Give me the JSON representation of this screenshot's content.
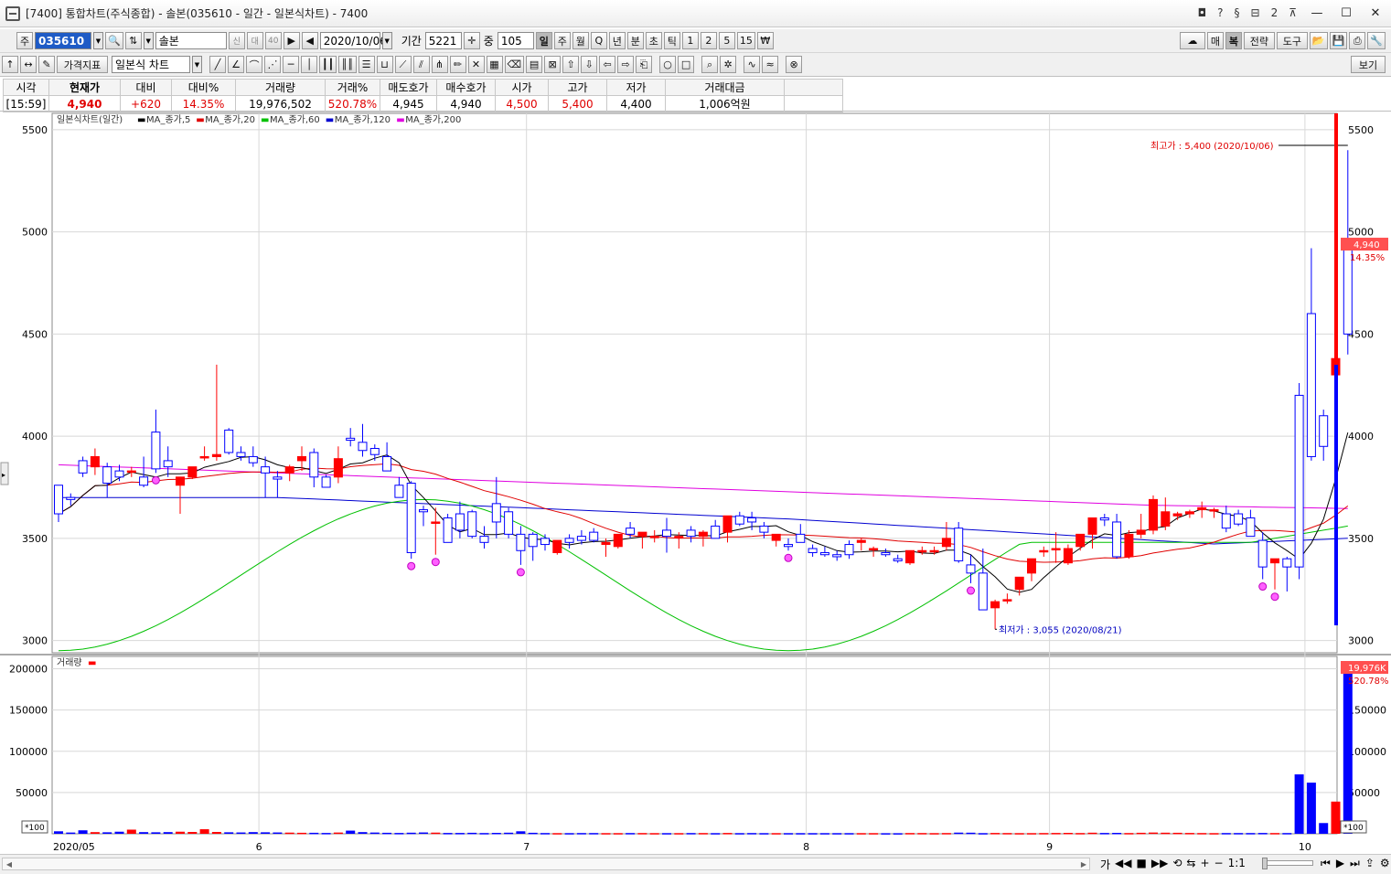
{
  "window": {
    "title": "[7400] 통합차트(주식종합) - 솔본(035610 - 일간 - 일본식차트) - 7400",
    "title_buttons": [
      "◘",
      "?",
      "§",
      "⊟",
      "2",
      "⊼"
    ],
    "min": "—",
    "max": "☐",
    "close": "✕"
  },
  "toolbar1": {
    "type_label": "주",
    "code": "035610",
    "name": "솔본",
    "badges": [
      "신",
      "대",
      "40"
    ],
    "date": "2020/10/06",
    "period_label": "기간",
    "period_value": "5221",
    "count_label": "중",
    "count_value": "105",
    "intervals": [
      "일",
      "주",
      "월",
      "Q",
      "년",
      "분",
      "초",
      "틱",
      "1",
      "2",
      "5",
      "15",
      "₩"
    ],
    "active_interval": "일",
    "right_buttons": [
      "매",
      "복",
      "전략",
      "도구"
    ]
  },
  "toolbar2": {
    "indicator_label": "가격지표",
    "chart_type": "일본식 차트",
    "view_button": "보기"
  },
  "quote": {
    "headers": [
      "시각",
      "현재가",
      "대비",
      "대비%",
      "거래량",
      "거래%",
      "매도호가",
      "매수호가",
      "시가",
      "고가",
      "저가",
      "거래대금"
    ],
    "values": [
      "[15:59]",
      "4,940",
      "+620",
      "14.35%",
      "19,976,502",
      "520.78%",
      "4,945",
      "4,940",
      "4,500",
      "5,400",
      "4,400",
      "1,006억원"
    ]
  },
  "legend": {
    "chart_title": "일본식차트(일간)",
    "items": [
      {
        "name": "MA_종가,5",
        "color": "#000000"
      },
      {
        "name": "MA_종가,20",
        "color": "#e00000"
      },
      {
        "name": "MA_종가,60",
        "color": "#00c000"
      },
      {
        "name": "MA_종가,120",
        "color": "#0000d0"
      },
      {
        "name": "MA_종가,200",
        "color": "#e000e0"
      }
    ],
    "volume_label": "거래량"
  },
  "annotations": {
    "high": "최고가 : 5,400 (2020/10/06)",
    "low": "최저가 : 3,055 (2020/08/21)",
    "price_tag": "4,940",
    "price_pct": "14.35%",
    "volume_tag": "19,976K",
    "volume_pct": "520.78%",
    "multiplier": "*100"
  },
  "colors": {
    "up": "#ff0000",
    "down": "#0000ff",
    "grid": "#d8d8d8"
  },
  "bottom": {
    "zoom": "1:1",
    "icons": [
      "가",
      "◀◀",
      "■",
      "▶▶",
      "⟲",
      "⇆",
      "+",
      "−",
      "1:1"
    ]
  },
  "chart_data": {
    "type": "candlestick",
    "price_axis": {
      "min": 2940,
      "max": 5580,
      "ticks": [
        3000,
        3500,
        4000,
        4500,
        5000,
        5500
      ]
    },
    "volume_axis": {
      "min": 0,
      "max": 215000,
      "ticks": [
        50000,
        100000,
        150000,
        200000
      ]
    },
    "x_labels": [
      {
        "i": 0,
        "label": "2020/05"
      },
      {
        "i": 17,
        "label": "6"
      },
      {
        "i": 39,
        "label": "7"
      },
      {
        "i": 62,
        "label": "8"
      },
      {
        "i": 82,
        "label": "9"
      },
      {
        "i": 103,
        "label": "10"
      }
    ],
    "ohlc": [
      [
        3760,
        3760,
        3580,
        3620
      ],
      [
        3700,
        3720,
        3660,
        3690
      ],
      [
        3880,
        3900,
        3800,
        3820
      ],
      [
        3850,
        3940,
        3810,
        3900
      ],
      [
        3850,
        3870,
        3700,
        3770
      ],
      [
        3830,
        3860,
        3780,
        3800
      ],
      [
        3830,
        3850,
        3800,
        3830
      ],
      [
        3800,
        3900,
        3750,
        3760
      ],
      [
        4020,
        4130,
        3820,
        3840
      ],
      [
        3880,
        3950,
        3800,
        3850
      ],
      [
        3760,
        3800,
        3620,
        3800
      ],
      [
        3800,
        3840,
        3790,
        3850
      ],
      [
        3900,
        3950,
        3880,
        3900
      ],
      [
        3900,
        4350,
        3880,
        3910
      ],
      [
        4030,
        4040,
        3910,
        3920
      ],
      [
        3920,
        3950,
        3880,
        3900
      ],
      [
        3900,
        3950,
        3850,
        3870
      ],
      [
        3850,
        3900,
        3700,
        3820
      ],
      [
        3800,
        3830,
        3700,
        3790
      ],
      [
        3820,
        3860,
        3780,
        3850
      ],
      [
        3880,
        3950,
        3830,
        3900
      ],
      [
        3920,
        3940,
        3750,
        3800
      ],
      [
        3800,
        3810,
        3750,
        3750
      ],
      [
        3800,
        3950,
        3770,
        3890
      ],
      [
        3990,
        4040,
        3950,
        3980
      ],
      [
        3970,
        4060,
        3900,
        3930
      ],
      [
        3940,
        3960,
        3880,
        3910
      ],
      [
        3900,
        3970,
        3830,
        3830
      ],
      [
        3760,
        3800,
        3720,
        3700
      ],
      [
        3770,
        3780,
        3400,
        3430
      ],
      [
        3640,
        3660,
        3560,
        3630
      ],
      [
        3580,
        3650,
        3420,
        3580
      ],
      [
        3600,
        3620,
        3480,
        3480
      ],
      [
        3620,
        3680,
        3500,
        3540
      ],
      [
        3630,
        3640,
        3500,
        3510
      ],
      [
        3510,
        3560,
        3450,
        3480
      ],
      [
        3670,
        3800,
        3500,
        3580
      ],
      [
        3630,
        3650,
        3500,
        3520
      ],
      [
        3520,
        3560,
        3370,
        3440
      ],
      [
        3520,
        3530,
        3390,
        3460
      ],
      [
        3500,
        3520,
        3440,
        3470
      ],
      [
        3430,
        3460,
        3420,
        3490
      ],
      [
        3500,
        3520,
        3450,
        3480
      ],
      [
        3510,
        3540,
        3470,
        3490
      ],
      [
        3530,
        3550,
        3480,
        3490
      ],
      [
        3470,
        3500,
        3410,
        3480
      ],
      [
        3460,
        3500,
        3450,
        3520
      ],
      [
        3550,
        3580,
        3500,
        3520
      ],
      [
        3510,
        3530,
        3450,
        3530
      ],
      [
        3510,
        3540,
        3480,
        3510
      ],
      [
        3540,
        3600,
        3430,
        3510
      ],
      [
        3510,
        3530,
        3450,
        3510
      ],
      [
        3540,
        3560,
        3480,
        3510
      ],
      [
        3510,
        3540,
        3460,
        3530
      ],
      [
        3560,
        3590,
        3500,
        3500
      ],
      [
        3530,
        3560,
        3480,
        3610
      ],
      [
        3610,
        3630,
        3560,
        3570
      ],
      [
        3600,
        3630,
        3540,
        3580
      ],
      [
        3560,
        3580,
        3500,
        3530
      ],
      [
        3490,
        3500,
        3460,
        3520
      ],
      [
        3470,
        3500,
        3440,
        3460
      ],
      [
        3520,
        3570,
        3480,
        3480
      ],
      [
        3450,
        3470,
        3410,
        3430
      ],
      [
        3430,
        3460,
        3410,
        3420
      ],
      [
        3420,
        3440,
        3390,
        3410
      ],
      [
        3470,
        3490,
        3400,
        3420
      ],
      [
        3480,
        3500,
        3440,
        3490
      ],
      [
        3450,
        3460,
        3410,
        3450
      ],
      [
        3430,
        3450,
        3410,
        3420
      ],
      [
        3400,
        3420,
        3380,
        3390
      ],
      [
        3380,
        3420,
        3370,
        3440
      ],
      [
        3440,
        3460,
        3420,
        3440
      ],
      [
        3440,
        3460,
        3420,
        3440
      ],
      [
        3460,
        3580,
        3440,
        3500
      ],
      [
        3550,
        3580,
        3380,
        3390
      ],
      [
        3370,
        3420,
        3280,
        3330
      ],
      [
        3330,
        3450,
        3200,
        3150
      ],
      [
        3160,
        3200,
        3055,
        3190
      ],
      [
        3200,
        3230,
        3180,
        3200
      ],
      [
        3250,
        3300,
        3220,
        3310
      ],
      [
        3330,
        3400,
        3290,
        3400
      ],
      [
        3440,
        3460,
        3410,
        3440
      ],
      [
        3450,
        3530,
        3380,
        3450
      ],
      [
        3380,
        3470,
        3370,
        3450
      ],
      [
        3460,
        3520,
        3440,
        3520
      ],
      [
        3520,
        3560,
        3450,
        3600
      ],
      [
        3600,
        3620,
        3560,
        3590
      ],
      [
        3580,
        3620,
        3400,
        3410
      ],
      [
        3410,
        3540,
        3400,
        3520
      ],
      [
        3520,
        3620,
        3500,
        3540
      ],
      [
        3540,
        3710,
        3520,
        3690
      ],
      [
        3560,
        3700,
        3540,
        3630
      ],
      [
        3610,
        3630,
        3590,
        3620
      ],
      [
        3620,
        3640,
        3600,
        3630
      ],
      [
        3640,
        3680,
        3600,
        3650
      ],
      [
        3640,
        3650,
        3600,
        3640
      ],
      [
        3620,
        3660,
        3530,
        3550
      ],
      [
        3620,
        3640,
        3560,
        3570
      ],
      [
        3600,
        3640,
        3530,
        3510
      ],
      [
        3490,
        3530,
        3300,
        3360
      ],
      [
        3380,
        3400,
        3250,
        3400
      ],
      [
        3400,
        3410,
        3240,
        3360
      ],
      [
        4200,
        4260,
        3300,
        3360
      ],
      [
        4600,
        4920,
        3880,
        3900
      ],
      [
        4100,
        4130,
        3880,
        3950
      ],
      [
        4300,
        4590,
        4160,
        4380
      ],
      [
        4940,
        5400,
        4400,
        4500
      ]
    ],
    "volume_x100": [
      3000,
      1500,
      4200,
      2000,
      1800,
      2500,
      5000,
      2000,
      1800,
      2000,
      2500,
      2200,
      5500,
      2200,
      1800,
      1600,
      2000,
      1800,
      1600,
      1400,
      1200,
      1200,
      1000,
      1500,
      3800,
      2000,
      1500,
      1200,
      1000,
      1300,
      1600,
      1400,
      1000,
      1000,
      1200,
      900,
      1100,
      1300,
      3000,
      1200,
      900,
      800,
      800,
      900,
      900,
      800,
      800,
      900,
      900,
      800,
      800,
      800,
      900,
      900,
      800,
      1000,
      800,
      900,
      800,
      800,
      800,
      800,
      800,
      800,
      800,
      800,
      800,
      800,
      700,
      700,
      900,
      900,
      800,
      900,
      1400,
      1300,
      800,
      1000,
      900,
      800,
      800,
      900,
      1000,
      1100,
      900,
      1300,
      1000,
      1100,
      900,
      1200,
      1500,
      1300,
      1200,
      1000,
      900,
      800,
      900,
      900,
      900,
      1000,
      900,
      900,
      72000,
      62000,
      13000,
      39000,
      199760
    ]
  }
}
